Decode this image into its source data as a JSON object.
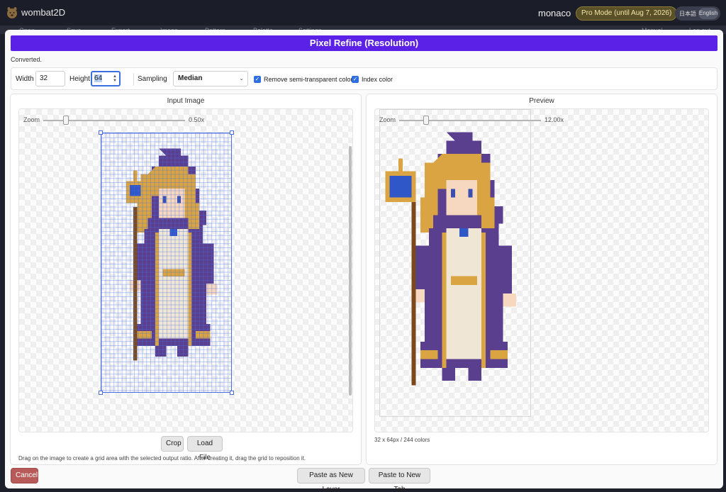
{
  "app": {
    "title": "wombat2D",
    "logo_icon": "wombat-logo-icon"
  },
  "user": {
    "name": "monaco"
  },
  "pro_badge": "Pro Mode (until Aug 7, 2026)",
  "language": {
    "ja": "日本語",
    "en": "English",
    "selected": "English"
  },
  "menubar": {
    "items": [
      "Open",
      "Save",
      "Export",
      "Image",
      "Pattern",
      "Palette",
      "Settings",
      "Manual",
      "Log out"
    ]
  },
  "modal": {
    "title": "Pixel Refine (Resolution)",
    "status": "Converted.",
    "settings": {
      "width_label": "Width",
      "width_value": "32",
      "height_label": "Height",
      "height_value": "64",
      "sampling_label": "Sampling",
      "sampling_value": "Median",
      "remove_semi_label": "Remove semi-transparent colors",
      "remove_semi_checked": true,
      "index_color_label": "Index color",
      "index_color_checked": true
    },
    "input_panel": {
      "title": "Input Image",
      "zoom_label": "Zoom",
      "zoom_value": "0.50x",
      "crop_button": "Crop",
      "load_button": "Load File",
      "hint": "Drag on the image to create a grid area with the selected output ratio. After creating it, drag the grid to reposition it."
    },
    "preview_panel": {
      "title": "Preview",
      "zoom_label": "Zoom",
      "zoom_value": "12.00x",
      "info": "32 x 64px / 244 colors"
    },
    "footer": {
      "cancel": "Cancel",
      "paste_layer": "Paste as New Layer",
      "paste_tab": "Paste to New Tab"
    }
  },
  "colors": {
    "accent": "#5b21e6",
    "selection": "#4a6ee0",
    "cancel": "#b85a5a",
    "hood_purple": "#5b3f8f",
    "hair_gold": "#d9a441"
  }
}
